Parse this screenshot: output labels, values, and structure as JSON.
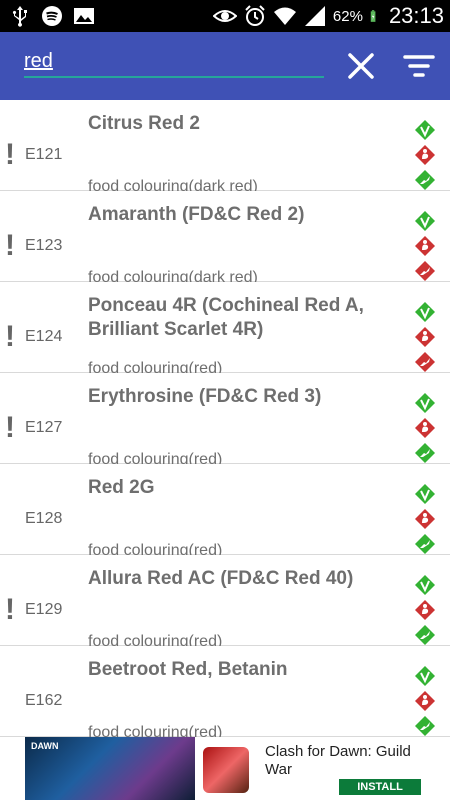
{
  "status_bar": {
    "battery_percent": "62%",
    "time": "23:13",
    "left_icons": [
      "usb-icon",
      "spotify-icon",
      "image-icon"
    ],
    "right_icons": [
      "eye-icon",
      "alarm-icon",
      "wifi-icon",
      "signal-icon",
      "battery-icon"
    ]
  },
  "search": {
    "value": "red",
    "clear_icon": "close-icon",
    "filter_icon": "filter-icon"
  },
  "colors": {
    "toolbar": "#3f51b5",
    "input_underline": "#26a69a",
    "vegan_green": "#33b233",
    "warning_red": "#cc3333"
  },
  "items": [
    {
      "code": "E121",
      "name": "Citrus Red 2",
      "desc": "food colouring(dark red)",
      "warning": "!",
      "badges": [
        "vegan",
        "pregnancy",
        "vegetarian"
      ]
    },
    {
      "code": "E123",
      "name": "Amaranth (FD&C Red 2)",
      "desc": "food colouring(dark red)",
      "warning": "!",
      "badges": [
        "vegan",
        "pregnancy",
        "vegetarian-red"
      ]
    },
    {
      "code": "E124",
      "name": "Ponceau 4R (Cochineal Red A, Brilliant Scarlet 4R)",
      "desc": "food colouring(red)",
      "warning": "!",
      "badges": [
        "vegan",
        "pregnancy",
        "vegetarian-red"
      ]
    },
    {
      "code": "E127",
      "name": "Erythrosine (FD&C Red 3)",
      "desc": "food colouring(red)",
      "warning": "!",
      "badges": [
        "vegan",
        "pregnancy",
        "vegetarian"
      ]
    },
    {
      "code": "E128",
      "name": "Red 2G",
      "desc": "food colouring(red)",
      "warning": "",
      "badges": [
        "vegan",
        "pregnancy",
        "vegetarian"
      ]
    },
    {
      "code": "E129",
      "name": "Allura Red AC (FD&C Red 40)",
      "desc": "food colouring(red)",
      "warning": "!",
      "badges": [
        "vegan",
        "pregnancy",
        "vegetarian"
      ]
    },
    {
      "code": "E162",
      "name": "Beetroot Red, Betanin",
      "desc": "food colouring(red)",
      "warning": "",
      "badges": [
        "vegan",
        "pregnancy",
        "vegetarian"
      ]
    }
  ],
  "ad": {
    "thumb_label": "DAWN",
    "title": "Clash for Dawn: Guild War",
    "cta": "INSTALL"
  }
}
